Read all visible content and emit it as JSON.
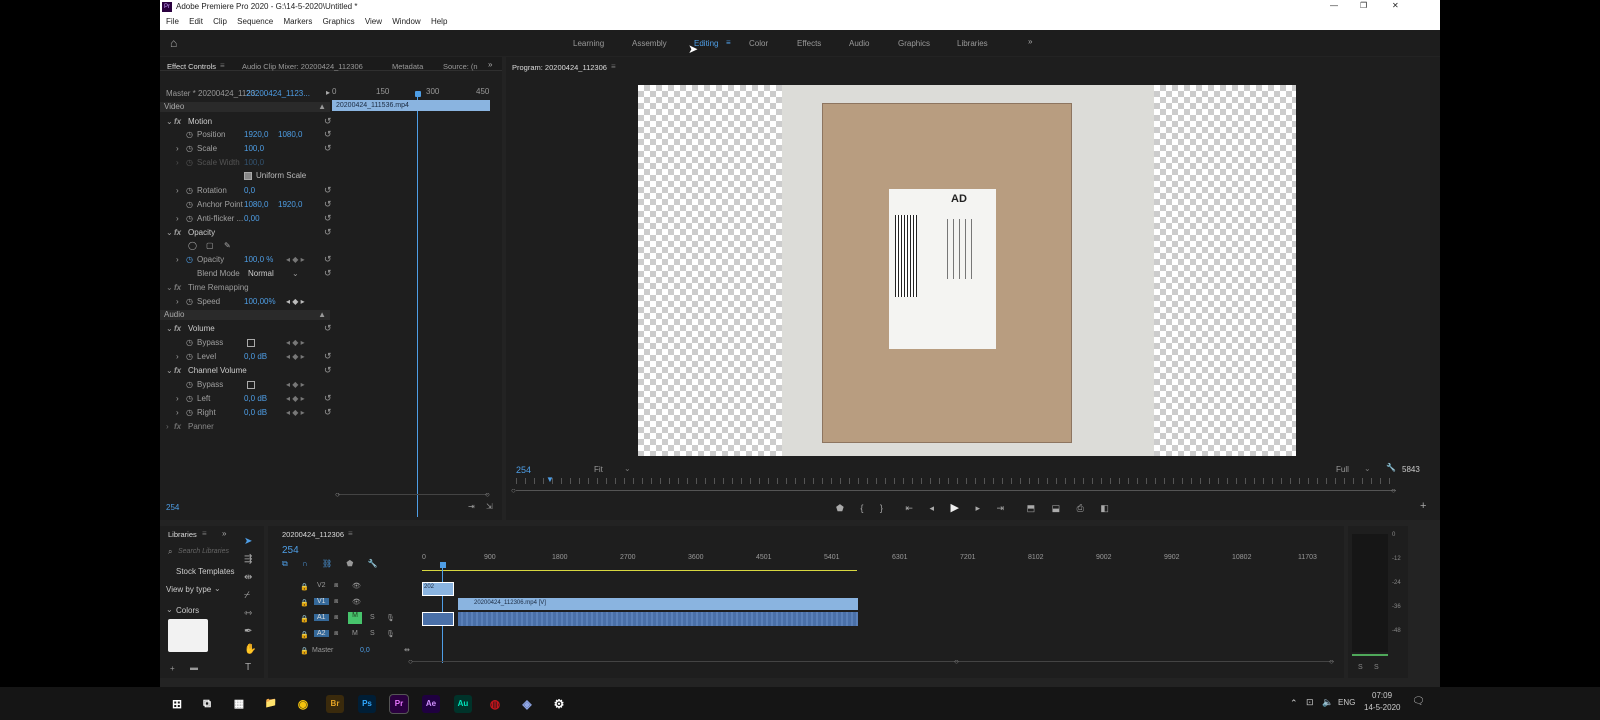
{
  "window": {
    "title": "Adobe Premiere Pro 2020 - G:\\14-5-2020\\Untitled *",
    "minimize": "—",
    "maximize": "❐",
    "close": "✕"
  },
  "menu": [
    "File",
    "Edit",
    "Clip",
    "Sequence",
    "Markers",
    "Graphics",
    "View",
    "Window",
    "Help"
  ],
  "workspaces": [
    "Learning",
    "Assembly",
    "Editing",
    "Color",
    "Effects",
    "Audio",
    "Graphics",
    "Libraries"
  ],
  "effect_panel": {
    "tabs": [
      "Effect Controls",
      "Audio Clip Mixer: 20200424_112306",
      "Metadata",
      "Source: (n"
    ],
    "master": "Master * 20200424_1123...",
    "clip_name": "20200424_1123...",
    "ruler": [
      "0",
      "150",
      "300",
      "450"
    ],
    "clip_bar": "20200424_111536.mp4",
    "video_label": "Video",
    "audio_label": "Audio",
    "motion": "Motion",
    "position_label": "Position",
    "position_x": "1920,0",
    "position_y": "1080,0",
    "scale_label": "Scale",
    "scale_val": "100,0",
    "scale_width_label": "Scale Width",
    "scale_width_val": "100,0",
    "uniform_scale": "Uniform Scale",
    "rotation_label": "Rotation",
    "rotation_val": "0,0",
    "anchor_label": "Anchor Point",
    "anchor_x": "1080,0",
    "anchor_y": "1920,0",
    "antiflicker_label": "Anti-flicker ...",
    "antiflicker_val": "0,00",
    "opacity_section": "Opacity",
    "opacity_label": "Opacity",
    "opacity_val": "100,0 %",
    "blend_label": "Blend Mode",
    "blend_val": "Normal",
    "time_remap": "Time Remapping",
    "speed_label": "Speed",
    "speed_val": "100,00%",
    "volume": "Volume",
    "bypass_label": "Bypass",
    "level_label": "Level",
    "level_val": "0,0 dB",
    "channel_volume": "Channel Volume",
    "left_label": "Left",
    "left_val": "0,0 dB",
    "right_label": "Right",
    "right_val": "0,0 dB",
    "panner": "Panner",
    "timecode": "254"
  },
  "program": {
    "tab": "Program: 20200424_112306",
    "timecode": "254",
    "fit": "Fit",
    "full": "Full",
    "duration": "5843",
    "label_text": "AD"
  },
  "libraries": {
    "tab": "Libraries",
    "search_placeholder": "Search Libraries",
    "stock": "Stock Templates",
    "view_by": "View by type",
    "colors": "Colors"
  },
  "timeline": {
    "tab": "20200424_112306",
    "timecode": "254",
    "ruler": [
      "0",
      "900",
      "1800",
      "2700",
      "3600",
      "4501",
      "5401",
      "6301",
      "7201",
      "8102",
      "9002",
      "9902",
      "10802",
      "11703"
    ],
    "tracks": [
      "V2",
      "V1",
      "A1",
      "A2",
      "Master"
    ],
    "master_val": "0,0",
    "v1_clip": "20200424_112306.mp4 [V]",
    "v2_clip": "202"
  },
  "meters": {
    "scale": [
      "0",
      "-12",
      "-24",
      "-36",
      "-48"
    ],
    "solo": "S"
  },
  "taskbar": {
    "lang": "ENG",
    "time": "07:09",
    "date": "14-5-2020",
    "apps": [
      {
        "label": "⊞",
        "color": "#151515"
      },
      {
        "label": "⧉",
        "color": "#151515"
      },
      {
        "label": "▦",
        "color": "#151515"
      },
      {
        "label": "📁",
        "color": "#e3b33b"
      },
      {
        "label": "◉",
        "color": "#db4437"
      },
      {
        "label": "Br",
        "color": "#3a2a0c"
      },
      {
        "label": "Ps",
        "color": "#001e36"
      },
      {
        "label": "Pr",
        "color": "#2a003f"
      },
      {
        "label": "Ae",
        "color": "#1f0040"
      },
      {
        "label": "Au",
        "color": "#00332a"
      },
      {
        "label": "◍",
        "color": "#c0151c"
      },
      {
        "label": "◈",
        "color": "#2b3a6b"
      },
      {
        "label": "⚙",
        "color": "#151515"
      }
    ]
  },
  "colors": {
    "accent": "#4e9ee6",
    "clip": "#8ab4e0",
    "audio_clip": "#4a70a8"
  }
}
